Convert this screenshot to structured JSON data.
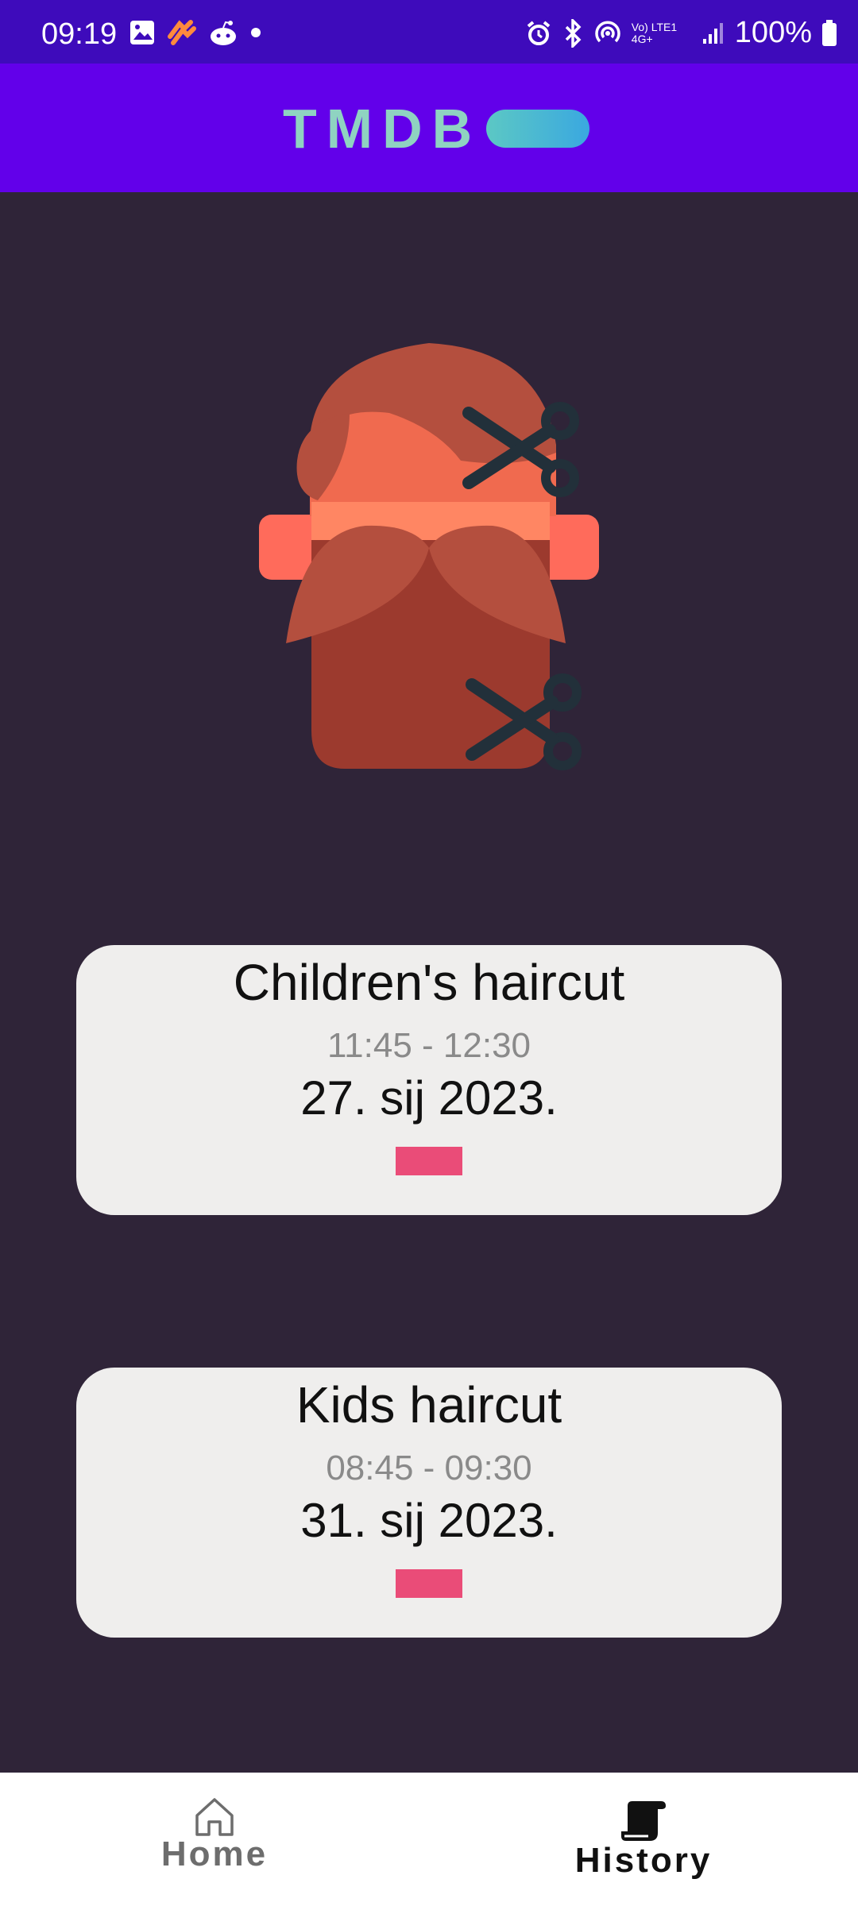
{
  "status_bar": {
    "time": "09:19",
    "battery": "100%",
    "network": "Vo) LTE1 4G+"
  },
  "app_bar": {
    "logo_text": "TMDB"
  },
  "appointments": [
    {
      "title": "Children's haircut",
      "time": "11:45 - 12:30",
      "date": "27. sij 2023."
    },
    {
      "title": "Kids haircut",
      "time": "08:45 - 09:30",
      "date": "31. sij 2023."
    }
  ],
  "nav": {
    "home_label": "Home",
    "history_label": "History",
    "active": "History"
  },
  "colors": {
    "status_bar": "#3e0bbb",
    "app_bar": "#6200ea",
    "background": "#2f2438",
    "card": "#efeeed",
    "tag": "#ea4c78"
  },
  "icons": {
    "hero": "barber-haircut-illustration",
    "home": "home-icon",
    "history": "scroll-icon"
  }
}
